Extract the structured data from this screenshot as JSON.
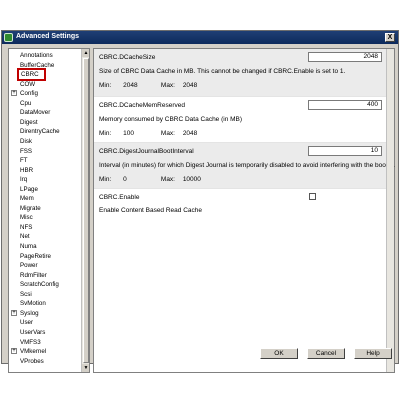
{
  "window": {
    "title": "Advanced Settings",
    "close_label": "X"
  },
  "tree": {
    "items": [
      {
        "label": "Annotations",
        "expandable": false
      },
      {
        "label": "BufferCache",
        "expandable": false
      },
      {
        "label": "CBRC",
        "expandable": false,
        "selected": true
      },
      {
        "label": "COW",
        "expandable": false
      },
      {
        "label": "Config",
        "expandable": true
      },
      {
        "label": "Cpu",
        "expandable": false
      },
      {
        "label": "DataMover",
        "expandable": false
      },
      {
        "label": "Digest",
        "expandable": false
      },
      {
        "label": "DirentryCache",
        "expandable": false
      },
      {
        "label": "Disk",
        "expandable": false
      },
      {
        "label": "FSS",
        "expandable": false
      },
      {
        "label": "FT",
        "expandable": false
      },
      {
        "label": "HBR",
        "expandable": false
      },
      {
        "label": "Irq",
        "expandable": false
      },
      {
        "label": "LPage",
        "expandable": false
      },
      {
        "label": "Mem",
        "expandable": false
      },
      {
        "label": "Migrate",
        "expandable": false
      },
      {
        "label": "Misc",
        "expandable": false
      },
      {
        "label": "NFS",
        "expandable": false
      },
      {
        "label": "Net",
        "expandable": false
      },
      {
        "label": "Numa",
        "expandable": false
      },
      {
        "label": "PageRetire",
        "expandable": false
      },
      {
        "label": "Power",
        "expandable": false
      },
      {
        "label": "RdmFilter",
        "expandable": false
      },
      {
        "label": "ScratchConfig",
        "expandable": false
      },
      {
        "label": "Scsi",
        "expandable": false
      },
      {
        "label": "SvMotion",
        "expandable": false
      },
      {
        "label": "Syslog",
        "expandable": true
      },
      {
        "label": "User",
        "expandable": false
      },
      {
        "label": "UserVars",
        "expandable": false
      },
      {
        "label": "VMFS3",
        "expandable": false
      },
      {
        "label": "VMkernel",
        "expandable": true
      },
      {
        "label": "VProbes",
        "expandable": false
      }
    ]
  },
  "settings": [
    {
      "name": "CBRC.DCacheSize",
      "value": "2048",
      "description": "Size of CBRC Data Cache in MB. This cannot be changed if CBRC.Enable is set to 1.",
      "min_label": "Min:",
      "min": "2048",
      "max_label": "Max:",
      "max": "2048",
      "shaded": true
    },
    {
      "name": "CBRC.DCacheMemReserved",
      "value": "400",
      "description": "Memory consumed by CBRC Data Cache (in MB)",
      "min_label": "Min:",
      "min": "100",
      "max_label": "Max:",
      "max": "2048",
      "shaded": false
    },
    {
      "name": "CBRC.DigestJournalBootInterval",
      "value": "10",
      "description": "Interval (in minutes) for which Digest Journal is temporarily disabled to avoid interfering with the boot ...",
      "min_label": "Min:",
      "min": "0",
      "max_label": "Max:",
      "max": "10000",
      "shaded": true
    },
    {
      "name": "CBRC.Enable",
      "checked": false,
      "description": "Enable Content Based Read Cache",
      "shaded": false
    }
  ],
  "buttons": {
    "ok": "OK",
    "cancel": "Cancel",
    "help": "Help"
  }
}
